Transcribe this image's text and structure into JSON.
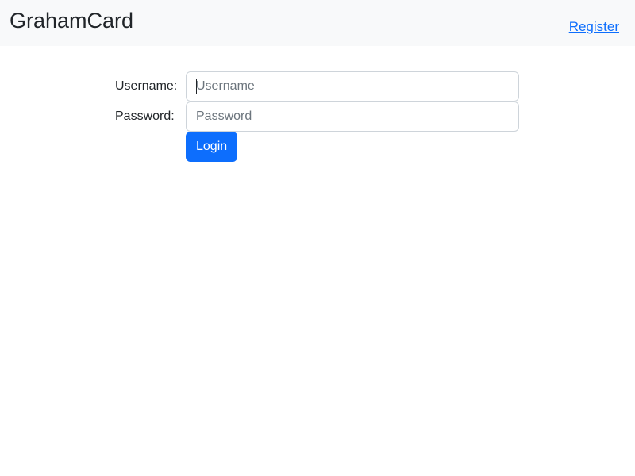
{
  "navbar": {
    "brand": "GrahamCard",
    "register_link": "Register"
  },
  "login_form": {
    "username_label": "Username:",
    "username_placeholder": "Username",
    "username_value": "",
    "password_label": "Password:",
    "password_placeholder": "Password",
    "password_value": "",
    "submit_label": "Login"
  },
  "colors": {
    "primary": "#0d6efd",
    "navbar_bg": "#f8f9fa",
    "input_border": "#ced4da",
    "text": "#212529"
  }
}
